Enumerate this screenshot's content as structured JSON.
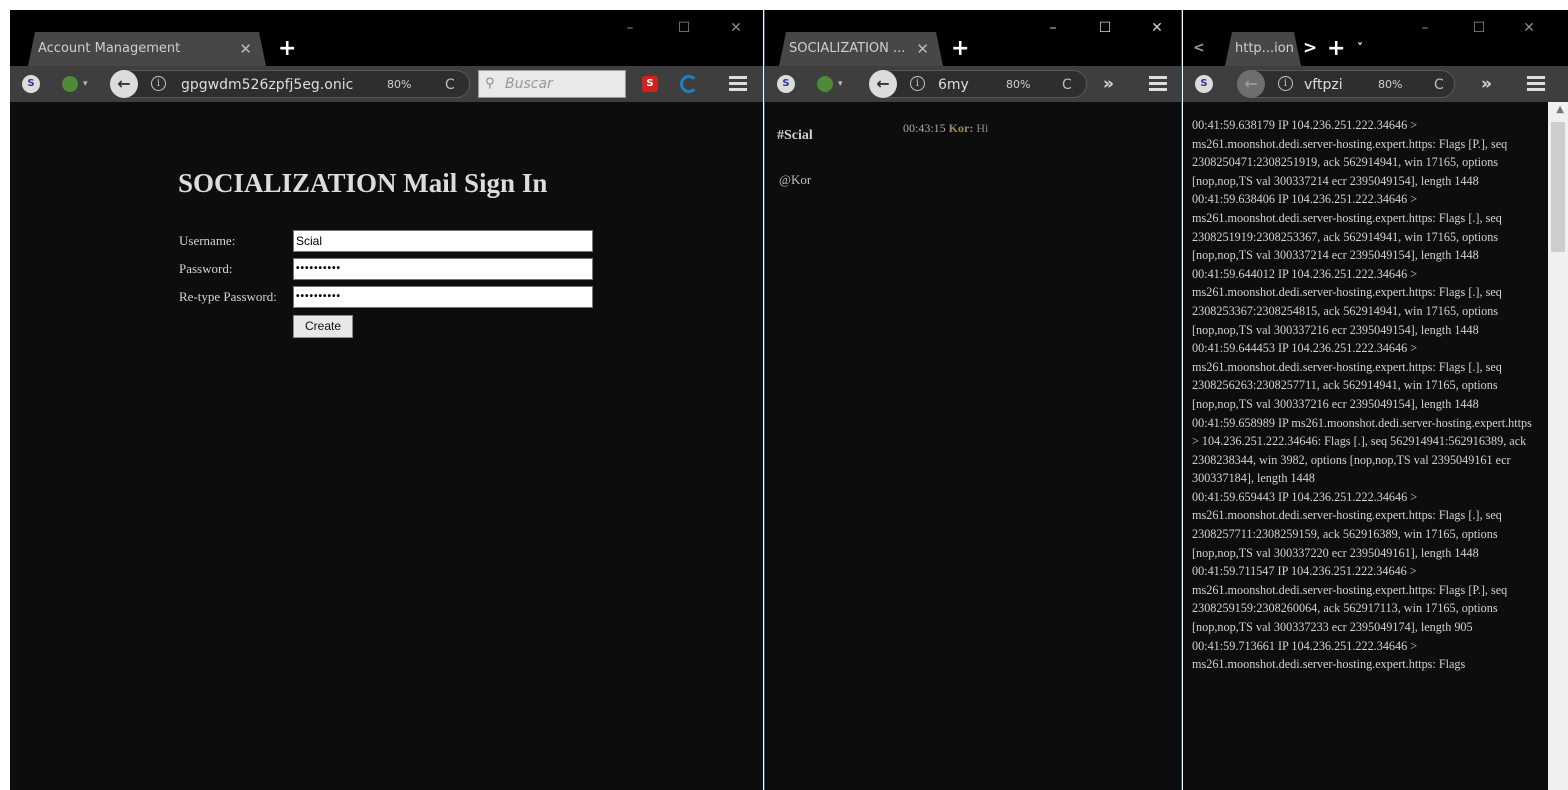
{
  "window1": {
    "tab_title": "Account Management",
    "tab_close": "✕",
    "new_tab": "+",
    "controls": {
      "minimize": "–",
      "maximize": "☐",
      "close": "✕"
    },
    "navbar": {
      "site_icon_text": "S",
      "back": "←",
      "info": "i",
      "url": "gpgwdm526zpfj5eg.onic",
      "zoom": "80%",
      "reload": "C",
      "search_placeholder": "Buscar",
      "search_icon": "⚲",
      "red_icon_text": "S"
    },
    "form": {
      "title": "SOCIALIZATION Mail Sign In",
      "username_label": "Username:",
      "username_value": "Scial",
      "password_label": "Password:",
      "password_value": "••••••••••",
      "retype_label": "Re-type Password:",
      "retype_value": "••••••••••",
      "create_label": "Create"
    }
  },
  "window2": {
    "tab_title": "SOCIALIZATION ...",
    "tab_close": "✕",
    "new_tab": "+",
    "controls": {
      "minimize": "–",
      "maximize": "☐",
      "close": "✕"
    },
    "navbar": {
      "site_icon_text": "S",
      "back": "←",
      "info": "i",
      "url": "6my",
      "zoom": "80%",
      "reload": "C",
      "overflow": "»"
    },
    "chat": {
      "channel": "#Scial",
      "time": "00:43:15",
      "nick": "Kor:",
      "message": "Hi",
      "user": "@Kor"
    }
  },
  "window3": {
    "tab_title": "http...ion",
    "tab_scroll_left": "<",
    "tab_scroll_right": ">",
    "new_tab": "+",
    "tab_list": "˅",
    "controls": {
      "minimize": "–",
      "maximize": "☐",
      "close": "✕"
    },
    "navbar": {
      "site_icon_text": "S",
      "back": "←",
      "info": "i",
      "url": "vftpzi",
      "zoom": "80%",
      "reload": "C",
      "overflow": "»"
    },
    "scroll_up": "▲",
    "log": "00:41:59.638179 IP 104.236.251.222.34646 > ms261.moonshot.dedi.server-hosting.expert.https: Flags [P.], seq 2308250471:2308251919, ack 562914941, win 17165, options [nop,nop,TS val 300337214 ecr 2395049154], length 1448\n00:41:59.638406 IP 104.236.251.222.34646 > ms261.moonshot.dedi.server-hosting.expert.https: Flags [.], seq 2308251919:2308253367, ack 562914941, win 17165, options [nop,nop,TS val 300337214 ecr 2395049154], length 1448\n00:41:59.644012 IP 104.236.251.222.34646 > ms261.moonshot.dedi.server-hosting.expert.https: Flags [.], seq 2308253367:2308254815, ack 562914941, win 17165, options [nop,nop,TS val 300337216 ecr 2395049154], length 1448\n00:41:59.644453 IP 104.236.251.222.34646 > ms261.moonshot.dedi.server-hosting.expert.https: Flags [.], seq 2308256263:2308257711, ack 562914941, win 17165, options [nop,nop,TS val 300337216 ecr 2395049154], length 1448\n00:41:59.658989 IP ms261.moonshot.dedi.server-hosting.expert.https > 104.236.251.222.34646: Flags [.], seq 562914941:562916389, ack 2308238344, win 3982, options [nop,nop,TS val 2395049161 ecr 300337184], length 1448\n00:41:59.659443 IP 104.236.251.222.34646 > ms261.moonshot.dedi.server-hosting.expert.https: Flags [.], seq 2308257711:2308259159, ack 562916389, win 17165, options [nop,nop,TS val 300337220 ecr 2395049161], length 1448\n00:41:59.711547 IP 104.236.251.222.34646 > ms261.moonshot.dedi.server-hosting.expert.https: Flags [P.], seq 2308259159:2308260064, ack 562917113, win 17165, options [nop,nop,TS val 300337233 ecr 2395049174], length 905\n00:41:59.713661 IP 104.236.251.222.34646 >\nms261.moonshot.dedi.server-hosting.expert.https: Flags"
  }
}
